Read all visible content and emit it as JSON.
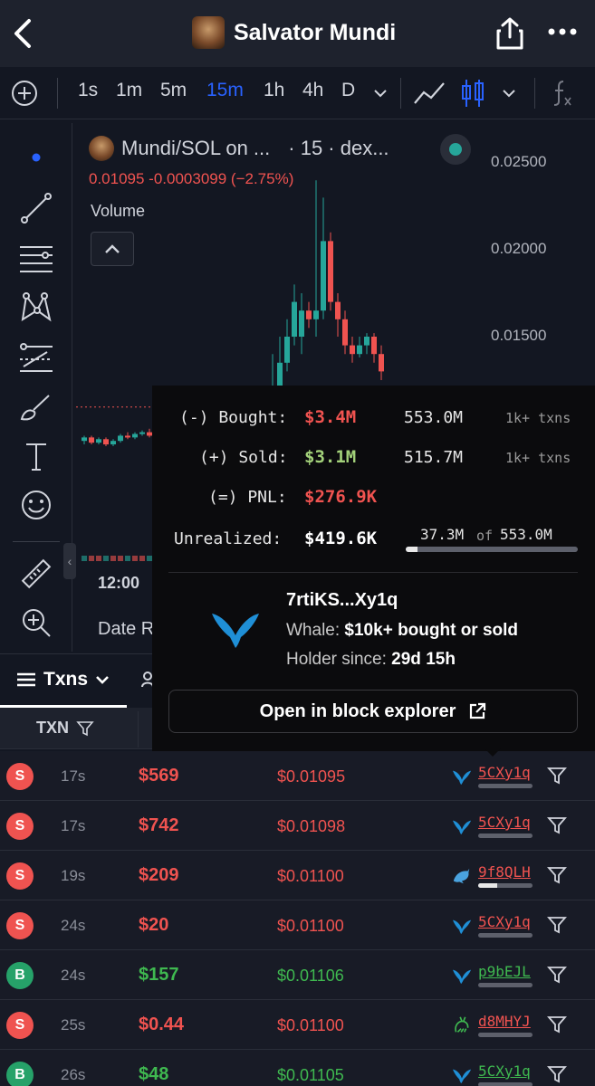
{
  "header": {
    "title": "Salvator Mundi"
  },
  "toolbar": {
    "intervals": [
      "1s",
      "1m",
      "5m",
      "15m",
      "1h",
      "4h",
      "D"
    ],
    "active_interval": "15m"
  },
  "chart": {
    "symbol_label": "Mundi/SOL on ...",
    "interval_label": "· 15 · dex...",
    "ohlc_line": "0.01095 -0.0003099 (−2.75%)",
    "volume_label": "Volume",
    "price_ticks": [
      "0.02500",
      "0.02000",
      "0.01500"
    ],
    "time_label": "12:00",
    "date_range_label": "Date R"
  },
  "chart_data": {
    "type": "candlestick",
    "price_ticks": [
      0.025,
      0.02,
      0.015
    ],
    "last_change": -0.0003099,
    "last_change_pct": -2.75,
    "last_close": 0.01095
  },
  "tabs": {
    "txns_label": "Txns"
  },
  "table": {
    "txn_header": "TXN",
    "rows": [
      {
        "type": "S",
        "age": "17s",
        "usd": "$569",
        "price": "$0.01095",
        "maker": "5CXy1q",
        "icon": "whale-icon",
        "bar": 0.0
      },
      {
        "type": "S",
        "age": "17s",
        "usd": "$742",
        "price": "$0.01098",
        "maker": "5CXy1q",
        "icon": "whale-icon",
        "bar": 0.0
      },
      {
        "type": "S",
        "age": "19s",
        "usd": "$209",
        "price": "$0.01100",
        "maker": "9f8QLH",
        "icon": "dolphin-icon",
        "bar": 0.35
      },
      {
        "type": "S",
        "age": "24s",
        "usd": "$20",
        "price": "$0.01100",
        "maker": "5CXy1q",
        "icon": "whale-icon",
        "bar": 0.0
      },
      {
        "type": "B",
        "age": "24s",
        "usd": "$157",
        "price": "$0.01106",
        "maker": "p9bEJL",
        "icon": "whale-icon",
        "bar": 0.0
      },
      {
        "type": "S",
        "age": "25s",
        "usd": "$0.44",
        "price": "$0.01100",
        "maker": "d8MHYJ",
        "icon": "shrimp-icon",
        "bar": 0.0
      },
      {
        "type": "B",
        "age": "26s",
        "usd": "$48",
        "price": "$0.01105",
        "maker": "5CXy1q",
        "icon": "whale-icon",
        "bar": 0.0
      }
    ]
  },
  "popup": {
    "bought_label": "(-) Bought:",
    "bought_value": "$3.4M",
    "bought_amount": "553.0M",
    "bought_txns": "1k+ txns",
    "sold_label": "(+) Sold:",
    "sold_value": "$3.1M",
    "sold_amount": "515.7M",
    "sold_txns": "1k+ txns",
    "pnl_label": "(=) PNL:",
    "pnl_value": "$276.9K",
    "unrealized_label": "Unrealized:",
    "unrealized_value": "$419.6K",
    "holding": "37.3M",
    "of_label": "of",
    "holding_total": "553.0M",
    "holding_fraction": 0.067,
    "wallet": "7rtiKS...Xy1q",
    "whale_label": "Whale:",
    "whale_value": "$10k+ bought or sold",
    "holder_label": "Holder since:",
    "holder_value": "29d 15h",
    "explorer_label": "Open in block explorer"
  },
  "colors": {
    "sell": "#f05350",
    "buy": "#3fb950",
    "accent": "#2962ff",
    "up_candle": "#26a69a",
    "down_candle": "#ef5350"
  }
}
